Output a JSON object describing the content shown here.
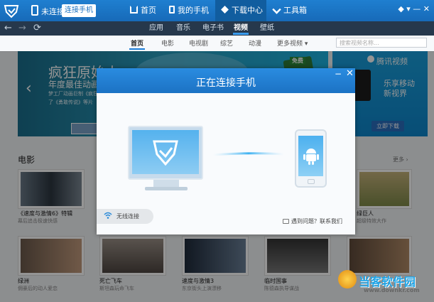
{
  "topbar": {
    "status_text": "未连接",
    "connect_button": "连接手机",
    "nav": [
      {
        "label": "首页"
      },
      {
        "label": "我的手机"
      },
      {
        "label": "下载中心"
      },
      {
        "label": "工具箱"
      }
    ],
    "window_controls": "◆ ▾ — ✕",
    "active_bg": "#115d9f"
  },
  "toolbar": {
    "back_icon": "arrow-left-icon",
    "forward_icon": "arrow-right-icon",
    "refresh_icon": "refresh-icon",
    "categories": [
      "应用",
      "音乐",
      "电子书",
      "视频",
      "壁纸"
    ],
    "active": "视频"
  },
  "subnav": {
    "items": [
      "首页",
      "电影",
      "电视剧",
      "综艺",
      "动漫",
      "更多视频 ▾"
    ],
    "search_placeholder": "搜索视频名称..."
  },
  "banner": {
    "title": "疯狂原始人",
    "subtitle": "年度最佳动画",
    "desc": "梦工厂动画巨制《疯狂原始人》",
    "desc2": "了《勇敢传说》等片",
    "prev_arrow": "‹",
    "tag": "免费"
  },
  "ad": {
    "brand": "腾讯视频",
    "line1": "乐享移动",
    "line2": "新视界",
    "button": "立即下载"
  },
  "movies": {
    "section_title": "电影",
    "more": "更多 ›",
    "row1": [
      {
        "title": "《速度与激情6》特辑",
        "sub": "幕后追击极速快感"
      },
      {
        "title": "",
        "sub": ""
      },
      {
        "title": "",
        "sub": ""
      },
      {
        "title": "",
        "sub": ""
      },
      {
        "title": "绿巨人",
        "sub": "超级特效大作"
      }
    ],
    "row2": [
      {
        "title": "绿洲",
        "sub": "佣豪后的动人爱恋"
      },
      {
        "title": "死亡飞车",
        "sub": "斯坦森玩命飞车"
      },
      {
        "title": "速度与激情3",
        "sub": "东京街头上演漂移"
      },
      {
        "title": "临时国事",
        "sub": "陈德森执导谋战"
      },
      {
        "title": "",
        "sub": ""
      }
    ]
  },
  "dialog": {
    "title": "正在连接手机",
    "minimize": "−",
    "close": "✕",
    "wifi_label": "无线连接",
    "help_label": "遇到问题？联系我们"
  },
  "watermark": {
    "brand": "当客软件园",
    "url": "www.downkr.com"
  }
}
